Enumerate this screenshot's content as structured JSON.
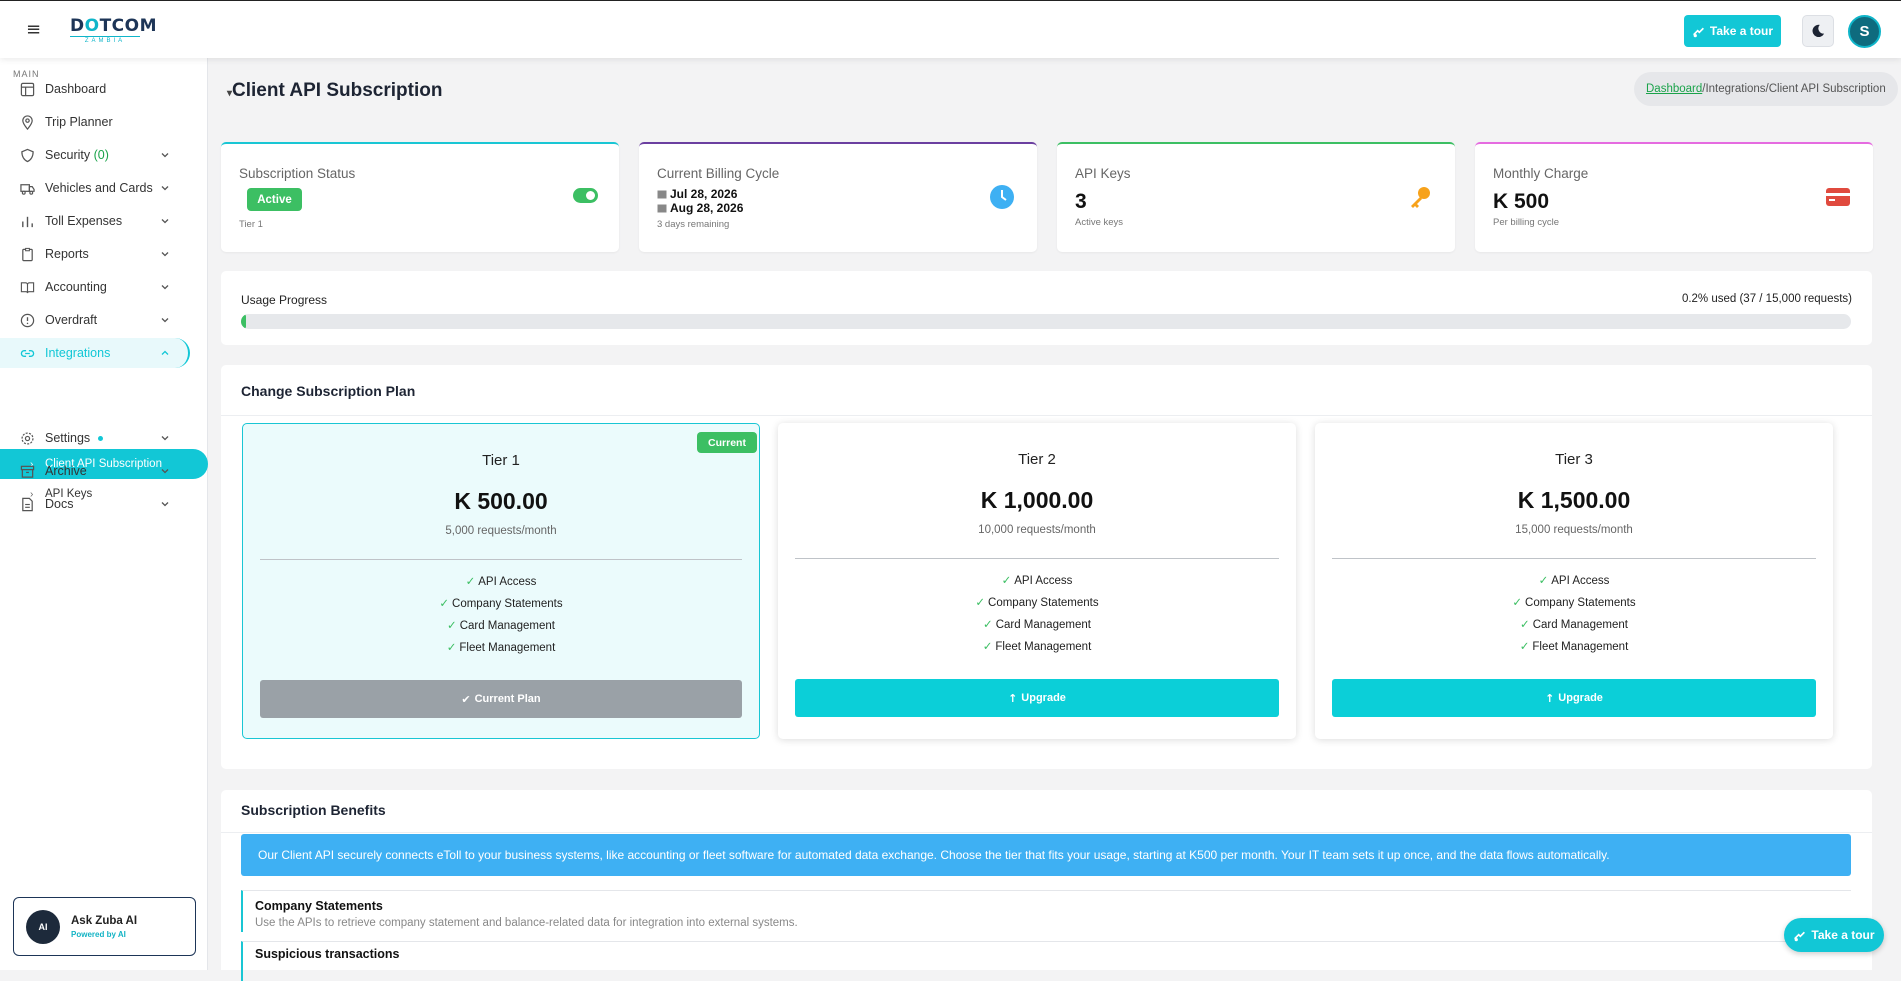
{
  "topbar": {
    "brand_pre": "D",
    "brand_o": "O",
    "brand_post": "TCOM",
    "brand_sub": "ZAMBIA",
    "tour_label": "Take a tour",
    "avatar_letter": "S"
  },
  "sidebar": {
    "section": "MAIN",
    "items": [
      {
        "label": "Dashboard",
        "icon": "layout-icon"
      },
      {
        "label": "Trip Planner",
        "icon": "map-pin-icon"
      },
      {
        "label": "Security",
        "count": "(0)",
        "icon": "shield-icon"
      },
      {
        "label": "Vehicles and Cards",
        "icon": "truck-icon"
      },
      {
        "label": "Toll Expenses",
        "icon": "bar-chart-icon"
      },
      {
        "label": "Reports",
        "icon": "clipboard-icon"
      },
      {
        "label": "Accounting",
        "icon": "book-icon"
      },
      {
        "label": "Overdraft",
        "icon": "alert-circle-icon"
      },
      {
        "label": "Integrations",
        "icon": "link-icon"
      },
      {
        "label": "Settings",
        "icon": "gear-icon"
      },
      {
        "label": "Archive",
        "icon": "archive-icon"
      },
      {
        "label": "Docs",
        "icon": "file-text-icon"
      }
    ],
    "subitems": [
      {
        "label": "Client API Subscription"
      },
      {
        "label": "API Keys"
      }
    ],
    "askzuba": {
      "logo": "AI",
      "title": "Ask Zuba AI",
      "subtitle": "Powered by AI"
    }
  },
  "header": {
    "title": "Client API Subscription",
    "breadcrumb_home": "Dashboard",
    "breadcrumb_rest": "/Integrations/Client API Subscription"
  },
  "stats": {
    "status": {
      "title": "Subscription Status",
      "badge": "Active",
      "tier": "Tier 1"
    },
    "billing": {
      "title": "Current Billing Cycle",
      "start": "Jul 28, 2026",
      "end": "Aug 28, 2026",
      "remaining": "3 days remaining"
    },
    "keys": {
      "title": "API Keys",
      "value": "3",
      "sub": "Active keys"
    },
    "charge": {
      "title": "Monthly Charge",
      "value": "K 500",
      "sub": "Per billing cycle"
    }
  },
  "usage": {
    "label": "Usage Progress",
    "summary": "0.2% used (37 / 15,000 requests)",
    "used_fraction": 0.0025
  },
  "plans": {
    "title": "Change Subscription Plan",
    "current_badge": "Current",
    "tiers": [
      {
        "name": "Tier 1",
        "price": "K 500.00",
        "requests": "5,000 requests/month",
        "features": [
          "API Access",
          "Company Statements",
          "Card Management",
          "Fleet Management"
        ],
        "button": "Current Plan"
      },
      {
        "name": "Tier 2",
        "price": "K 1,000.00",
        "requests": "10,000 requests/month",
        "features": [
          "API Access",
          "Company Statements",
          "Card Management",
          "Fleet Management"
        ],
        "button": "Upgrade"
      },
      {
        "name": "Tier 3",
        "price": "K 1,500.00",
        "requests": "15,000 requests/month",
        "features": [
          "API Access",
          "Company Statements",
          "Card Management",
          "Fleet Management"
        ],
        "button": "Upgrade"
      }
    ]
  },
  "benefits": {
    "title": "Subscription Benefits",
    "banner": "Our Client API securely connects eToll to your business systems, like accounting or fleet software for automated data exchange. Choose the tier that fits your usage, starting at K500 per month. Your IT team sets it up once, and the data flows automatically.",
    "items": [
      {
        "title": "Company Statements",
        "desc": "Use the APIs to retrieve company statement and balance-related data for integration into external systems."
      },
      {
        "title": "Suspicious transactions",
        "desc": ""
      }
    ]
  },
  "float": {
    "tour_label": "Take a tour"
  },
  "colors": {
    "accent": "#12c7d6",
    "success": "#3cbf63",
    "info": "#3eb0f3"
  }
}
